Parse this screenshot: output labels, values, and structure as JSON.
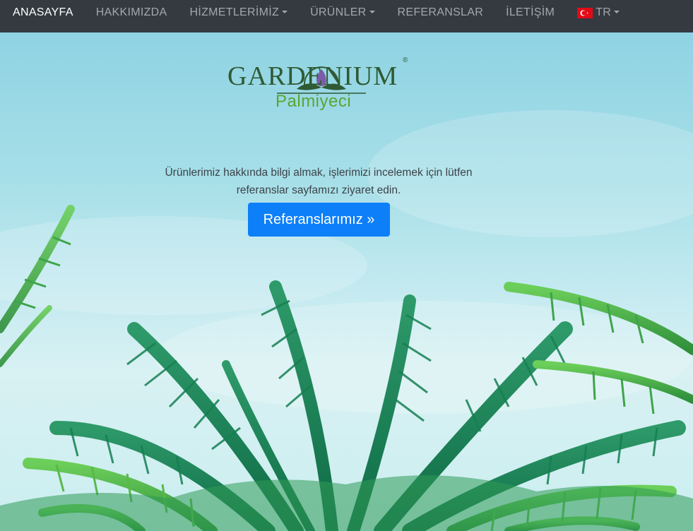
{
  "nav": {
    "items": [
      {
        "label": "ANASAYFA",
        "active": true,
        "dropdown": false
      },
      {
        "label": "HAKKIMIZDA",
        "active": false,
        "dropdown": false
      },
      {
        "label": "HİZMETLERİMİZ",
        "active": false,
        "dropdown": true
      },
      {
        "label": "ÜRÜNLER",
        "active": false,
        "dropdown": true
      },
      {
        "label": "REFERANSLAR",
        "active": false,
        "dropdown": false
      },
      {
        "label": "İLETİŞİM",
        "active": false,
        "dropdown": false
      }
    ],
    "language": {
      "label": "TR",
      "flag_icon": "turkey-flag-icon"
    }
  },
  "logo": {
    "brand": "GARDENIUM",
    "registered": "®",
    "sub": "Palmiyeci"
  },
  "hero": {
    "lead": "Ürünlerimiz hakkında bilgi almak, işlerimizi incelemek için lütfen referanslar sayfamızı ziyaret edin.",
    "cta_label": "Referanslarımız »"
  },
  "colors": {
    "navbar": "#343a40",
    "brand_dark_green": "#2f5a33",
    "brand_light_green": "#5aa531",
    "cta_blue": "#0d7ff8"
  }
}
